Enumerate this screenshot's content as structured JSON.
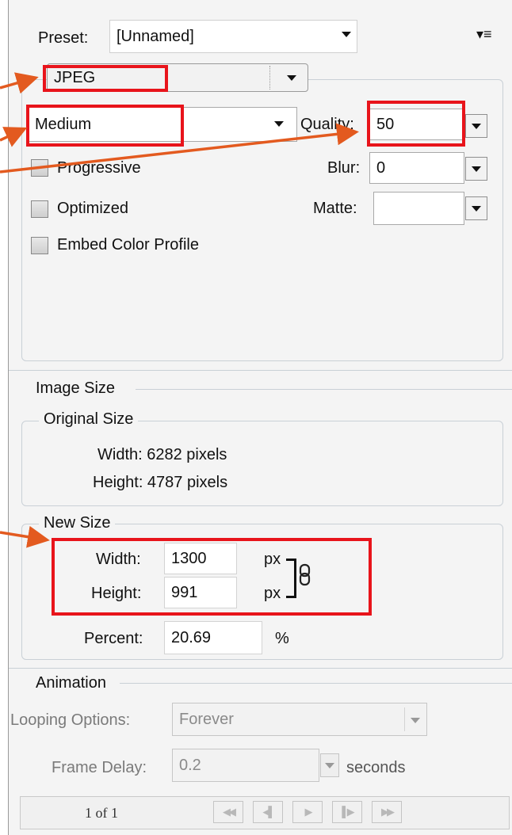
{
  "preset": {
    "label": "Preset:",
    "value": "[Unnamed]",
    "menu_icon": "panel-menu-icon"
  },
  "format": {
    "value": "JPEG"
  },
  "quality_preset": {
    "value": "Medium"
  },
  "quality": {
    "label": "Quality:",
    "value": "50"
  },
  "blur": {
    "label": "Blur:",
    "value": "0"
  },
  "matte": {
    "label": "Matte:",
    "value": ""
  },
  "options": {
    "progressive": {
      "label": "Progressive",
      "checked": false
    },
    "optimized": {
      "label": "Optimized",
      "checked": false
    },
    "embed_profile": {
      "label": "Embed Color Profile",
      "checked": false
    }
  },
  "image_size": {
    "title": "Image Size",
    "original": {
      "title": "Original Size",
      "width_text": "Width:  6282 pixels",
      "height_text": "Height:  4787 pixels"
    },
    "new": {
      "title": "New Size",
      "width_label": "Width:",
      "width_value": "1300",
      "height_label": "Height:",
      "height_value": "991",
      "unit": "px",
      "link_icon": "chain-link-icon",
      "percent_label": "Percent:",
      "percent_value": "20.69",
      "percent_unit": "%"
    }
  },
  "animation": {
    "title": "Animation",
    "looping_label": "Looping Options:",
    "looping_value": "Forever",
    "frame_delay_label": "Frame Delay:",
    "frame_delay_value": "0.2",
    "frame_delay_unit": "seconds",
    "frame_counter": "1 of 1",
    "nav_icons": [
      "first-frame-icon",
      "previous-frame-icon",
      "play-icon",
      "next-frame-icon",
      "last-frame-icon"
    ]
  },
  "colors": {
    "highlight": "#e8141b",
    "arrow": "#e35a1f"
  }
}
